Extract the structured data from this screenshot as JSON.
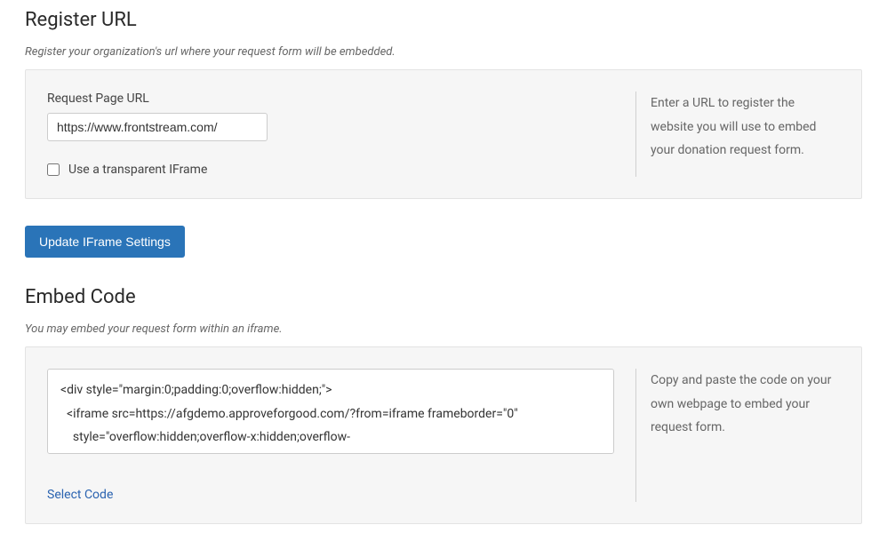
{
  "register": {
    "heading": "Register URL",
    "subtitle": "Register your organization's url where your request form will be embedded.",
    "urlLabel": "Request Page URL",
    "urlValue": "https://www.frontstream.com/",
    "transparentLabel": "Use a transparent IFrame",
    "helpText": "Enter a URL to register the website you will use to embed your donation request form."
  },
  "updateButton": "Update IFrame Settings",
  "embed": {
    "heading": "Embed Code",
    "subtitle": "You may embed your request form within an iframe.",
    "code": "<div style=\"margin:0;padding:0;overflow:hidden;\">\n  <iframe src=https://afgdemo.approveforgood.com/?from=iframe frameborder=\"0\"\n    style=\"overflow:hidden;overflow-x:hidden;overflow-",
    "selectLink": "Select Code",
    "helpText": "Copy and paste the code on your own webpage to embed your request form."
  }
}
